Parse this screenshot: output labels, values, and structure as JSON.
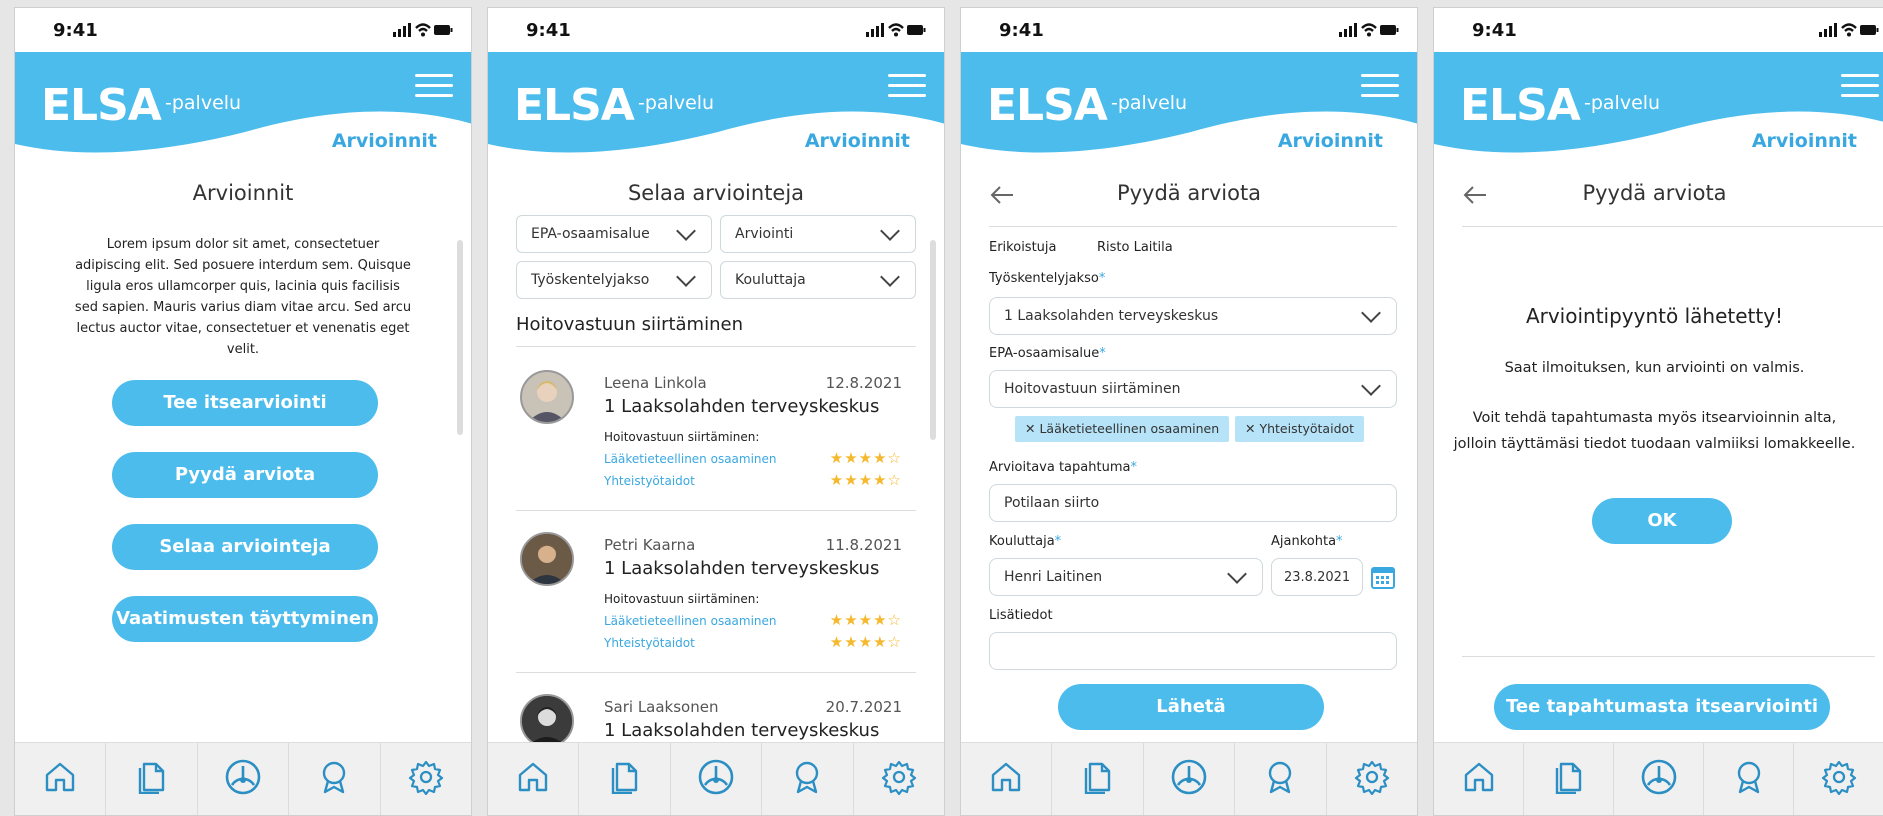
{
  "status": {
    "time": "9:41"
  },
  "brand": {
    "logo": "ELSA",
    "sub": "-palvelu",
    "section": "Arvioinnit"
  },
  "colors": {
    "accent": "#4bbcec",
    "accent_text": "#3aa8e0",
    "star": "#f5b82e"
  },
  "nav_icons": [
    "home-icon",
    "documents-icon",
    "gauge-icon",
    "award-icon",
    "settings-icon"
  ],
  "screen1": {
    "title": "Arvioinnit",
    "body": "Lorem ipsum dolor sit amet, consectetuer adipiscing elit. Sed posuere interdum sem. Quisque ligula eros ullamcorper quis, lacinia quis facilisis sed sapien. Mauris varius diam vitae arcu. Sed arcu lectus auctor vitae, consectetuer et venenatis eget velit.",
    "buttons": [
      "Tee itsearviointi",
      "Pyydä arviota",
      "Selaa arviointeja",
      "Vaatimusten täyttyminen"
    ]
  },
  "screen2": {
    "title": "Selaa arviointeja",
    "filters": [
      "EPA-osaamisalue",
      "Arviointi",
      "Työskentelyjakso",
      "Kouluttaja"
    ],
    "group_heading": "Hoitovastuun siirtäminen",
    "cards": [
      {
        "name": "Leena Linkola",
        "date": "12.8.2021",
        "place": "1 Laaksolahden terveyskeskus",
        "subject": "Hoitovastuun siirtäminen:",
        "skill1": "Lääketieteellinen osaaminen",
        "skill2": "Yhteistyötaidot",
        "stars1": "★★★★☆",
        "stars2": "★★★★☆",
        "rating1": 4,
        "rating2": 4
      },
      {
        "name": "Petri Kaarna",
        "date": "11.8.2021",
        "place": "1 Laaksolahden terveyskeskus",
        "subject": "Hoitovastuun siirtäminen:",
        "skill1": "Lääketieteellinen osaaminen",
        "skill2": "Yhteistyötaidot",
        "stars1": "★★★★☆",
        "stars2": "★★★★☆",
        "rating1": 4,
        "rating2": 4
      },
      {
        "name": "Sari Laaksonen",
        "date": "20.7.2021",
        "place": "1 Laaksolahden terveyskeskus"
      }
    ]
  },
  "screen3": {
    "title": "Pyydä arviota",
    "erikoistuja_label": "Erikoistuja",
    "erikoistuja_value": "Risto Laitila",
    "jakso_label": "Työskentelyjakso",
    "jakso_value": "1 Laaksolahden terveyskeskus",
    "epa_label": "EPA-osaamisalue",
    "epa_value": "Hoitovastuun siirtäminen",
    "chips": [
      "Lääketieteellinen osaaminen",
      "Yhteistyötaidot"
    ],
    "tapahtuma_label": "Arvioitava tapahtuma",
    "tapahtuma_value": "Potilaan siirto",
    "kouluttaja_label": "Kouluttaja",
    "kouluttaja_value": "Henri Laitinen",
    "ajankohta_label": "Ajankohta",
    "ajankohta_value": "23.8.2021",
    "lisatiedot_label": "Lisätiedot",
    "lisatiedot_value": "",
    "required_mark": "*",
    "submit": "Lähetä"
  },
  "screen4": {
    "title": "Pyydä arviota",
    "heading": "Arviointipyyntö lähetetty!",
    "line1": "Saat ilmoituksen, kun arviointi on valmis.",
    "line2": "Voit tehdä tapahtumasta myös itsearvioinnin alta,",
    "line3": "jolloin täyttämäsi tiedot tuodaan valmiiksi lomakkeelle.",
    "ok": "OK",
    "self_eval": "Tee tapahtumasta itsearviointi"
  }
}
